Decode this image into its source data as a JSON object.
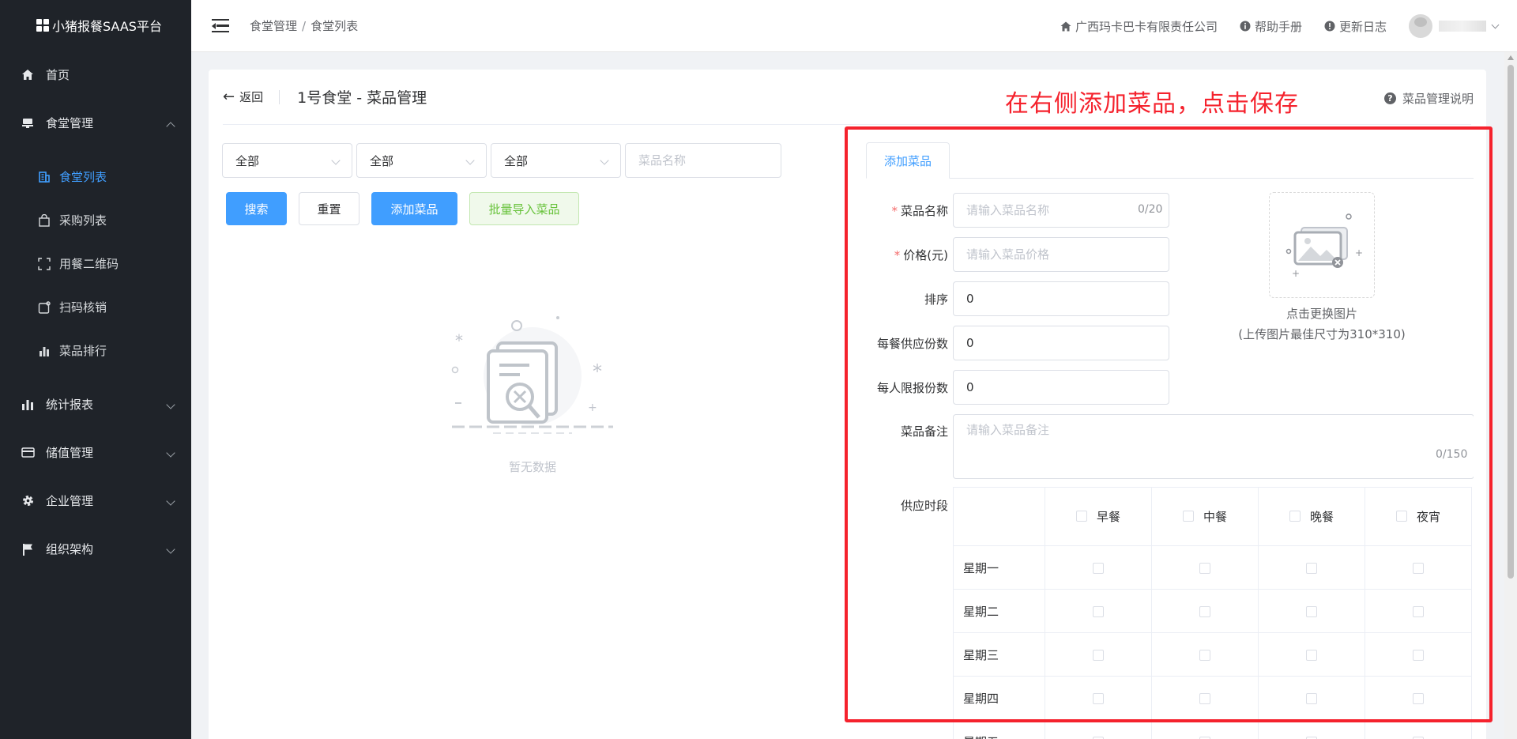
{
  "app": {
    "title": "小猪报餐SAAS平台"
  },
  "sidebar": {
    "items": [
      {
        "label": "首页",
        "icon": "home-icon"
      },
      {
        "label": "食堂管理",
        "icon": "canteen-icon",
        "expanded": true,
        "children": [
          {
            "label": "食堂列表",
            "icon": "building-icon",
            "active": true
          },
          {
            "label": "采购列表",
            "icon": "shopping-bag-icon"
          },
          {
            "label": "用餐二维码",
            "icon": "qrcode-icon"
          },
          {
            "label": "扫码核销",
            "icon": "scan-icon"
          },
          {
            "label": "菜品排行",
            "icon": "bar-chart-icon"
          }
        ]
      },
      {
        "label": "统计报表",
        "icon": "chart-icon"
      },
      {
        "label": "储值管理",
        "icon": "card-icon"
      },
      {
        "label": "企业管理",
        "icon": "gear-icon"
      },
      {
        "label": "组织架构",
        "icon": "flag-icon"
      }
    ]
  },
  "header": {
    "breadcrumb": [
      "食堂管理",
      "食堂列表"
    ],
    "separator": "/",
    "company": "广西玛卡巴卡有限责任公司",
    "help": "帮助手册",
    "changelog": "更新日志"
  },
  "page": {
    "back_label": "返回",
    "title": "1号食堂 - 菜品管理",
    "annotation": "在右侧添加菜品，点击保存",
    "help_link": "菜品管理说明"
  },
  "filters": {
    "select1": "全部",
    "select2": "全部",
    "select3": "全部",
    "name_placeholder": "菜品名称"
  },
  "buttons": {
    "search": "搜索",
    "reset": "重置",
    "add_dish": "添加菜品",
    "batch_import": "批量导入菜品"
  },
  "empty_state": {
    "text": "暂无数据"
  },
  "form": {
    "tab": "添加菜品",
    "name": {
      "label": "菜品名称",
      "placeholder": "请输入菜品名称",
      "counter": "0/20"
    },
    "price": {
      "label": "价格(元)",
      "placeholder": "请输入菜品价格"
    },
    "sort": {
      "label": "排序",
      "value": "0"
    },
    "per_meal": {
      "label": "每餐供应份数",
      "value": "0"
    },
    "per_person": {
      "label": "每人限报份数",
      "value": "0"
    },
    "remark": {
      "label": "菜品备注",
      "placeholder": "请输入菜品备注",
      "counter": "0/150"
    },
    "image": {
      "change_text": "点击更换图片",
      "hint": "(上传图片最佳尺寸为310*310)"
    },
    "supply": {
      "label": "供应时段",
      "meals": [
        "早餐",
        "中餐",
        "晚餐",
        "夜宵"
      ],
      "days": [
        "星期一",
        "星期二",
        "星期三",
        "星期四",
        "星期五"
      ]
    }
  },
  "colors": {
    "primary": "#409eff",
    "sidebar_bg": "#1f2329",
    "annotation": "#f5222d",
    "success": "#67c23a"
  }
}
